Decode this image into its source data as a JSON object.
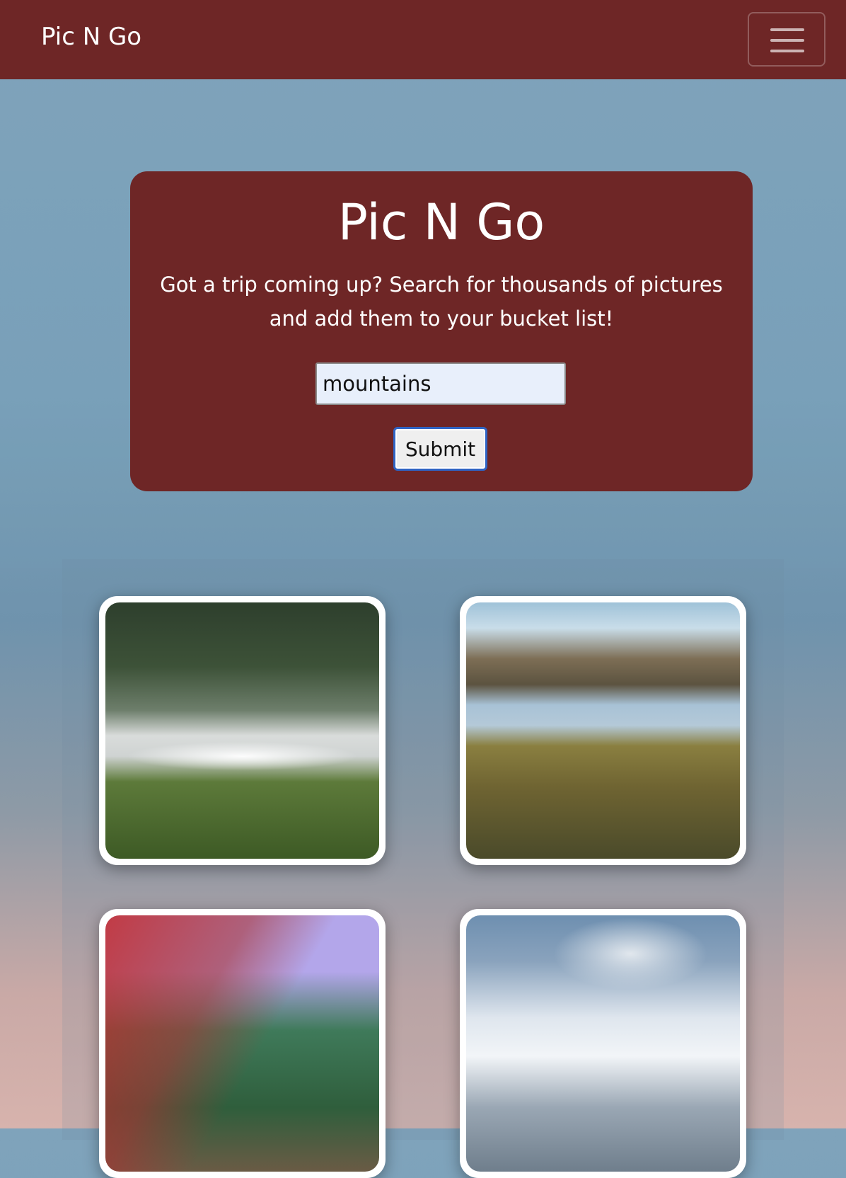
{
  "navbar": {
    "brand": "Pic N Go",
    "menu_icon": "hamburger-menu-icon"
  },
  "hero": {
    "title": "Pic N Go",
    "subtitle": "Got a trip coming up? Search for thousands of pictures and add them to your bucket list!",
    "search_value": "mountains",
    "submit_label": "Submit"
  },
  "colors": {
    "brand": "#6e2626",
    "submit_border": "#2f64c4",
    "input_bg": "#e8effb"
  },
  "gallery": {
    "images": [
      {
        "subject": "misty forest lake with grass"
      },
      {
        "subject": "mountain lake with autumn trees"
      },
      {
        "subject": "red and green forest canyon"
      },
      {
        "subject": "snowy mountain range under clouds"
      }
    ]
  }
}
